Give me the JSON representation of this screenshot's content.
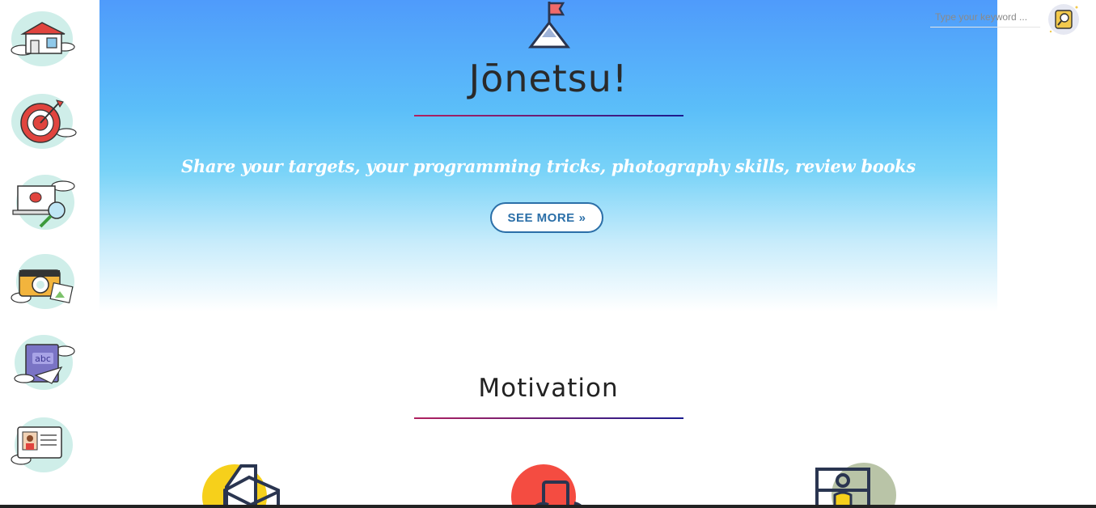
{
  "sidebar": {
    "items": [
      {
        "name": "home-icon"
      },
      {
        "name": "target-icon"
      },
      {
        "name": "programming-icon"
      },
      {
        "name": "camera-icon"
      },
      {
        "name": "book-icon"
      },
      {
        "name": "profile-card-icon"
      }
    ]
  },
  "search": {
    "placeholder": "Type your keyword ...",
    "button_icon": "search-icon"
  },
  "hero": {
    "icon": "mountain-flag-icon",
    "title": "Jōnetsu!",
    "tagline": "Share your targets, your programming tricks, photography skills, review books",
    "see_more_label": "SEE MORE",
    "see_more_icon": "double-chevron-right-icon"
  },
  "motivation": {
    "title": "Motivation",
    "features": [
      {
        "name": "envelope-icon",
        "color": "#f6d01b"
      },
      {
        "name": "phone-icon",
        "color": "#f44c41"
      },
      {
        "name": "profile-frame-icon",
        "color": "#b9c4a7"
      }
    ]
  },
  "colors": {
    "accent": "#2b6fa8",
    "hero_top": "#4f9bfb",
    "divider_start": "#b1215f",
    "divider_end": "#1b1b8f"
  }
}
